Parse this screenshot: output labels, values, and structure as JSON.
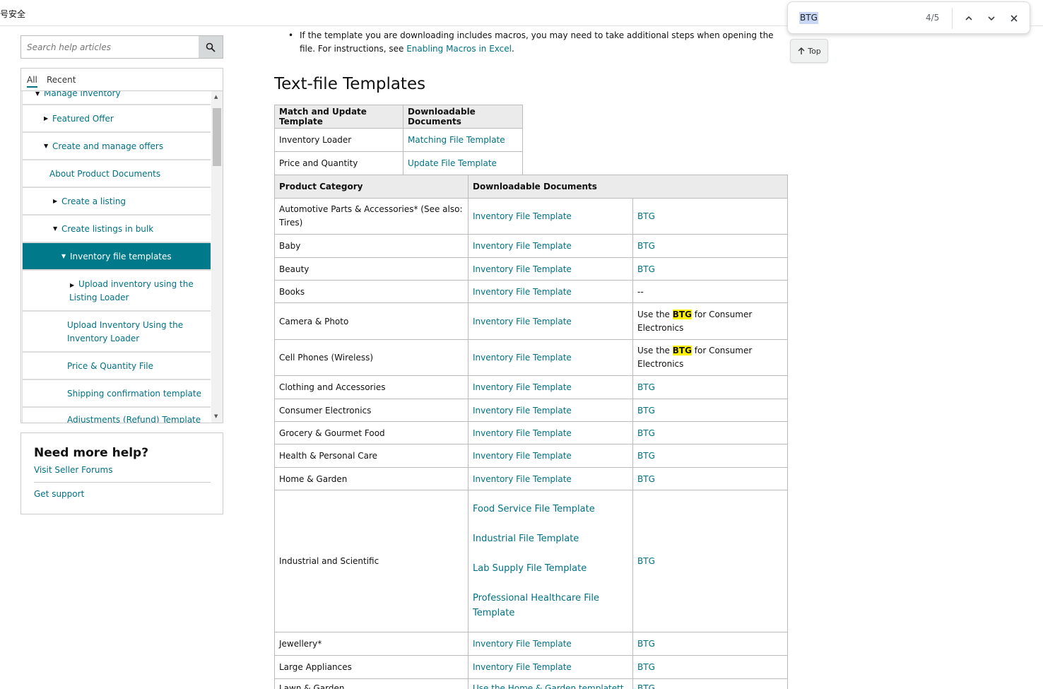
{
  "window": {
    "title": "号安全"
  },
  "find_bar": {
    "query": "BTG",
    "count": "4/5"
  },
  "top_button": {
    "label": "Top"
  },
  "sidebar": {
    "search_placeholder": "Search help articles",
    "tabs": [
      "All",
      "Recent"
    ],
    "items": [
      {
        "label": "Manage inventory"
      },
      {
        "label": "Featured Offer"
      },
      {
        "label": "Create and manage offers"
      },
      {
        "label": "About Product Documents"
      },
      {
        "label": "Create a listing"
      },
      {
        "label": "Create listings in bulk"
      },
      {
        "label": "Inventory file templates"
      },
      {
        "label": "Upload inventory using the",
        "label2": "Listing Loader"
      },
      {
        "label": "Upload Inventory Using the",
        "label2": "Inventory Loader"
      },
      {
        "label": "Price & Quantity File"
      },
      {
        "label": "Shipping confirmation template"
      },
      {
        "label": "Adjustments (Refund) Template"
      }
    ],
    "help": {
      "title": "Need more help?",
      "link1": "Visit Seller Forums",
      "link2": "Get support"
    }
  },
  "main": {
    "bullet_text": "If the template you are downloading includes macros, you may need to take additional steps when opening the file. For instructions, see ",
    "bullet_link": "Enabling Macros in Excel",
    "bullet_end": ".",
    "section_title": "Text-file Templates",
    "table1": {
      "headers": [
        "Match and Update Template",
        "Downloadable Documents"
      ],
      "rows": [
        [
          "Inventory Loader",
          "Matching File Template"
        ],
        [
          "Price and Quantity",
          "Update File Template"
        ]
      ]
    },
    "table2": {
      "headers": [
        "Product Category",
        "Downloadable Documents"
      ],
      "inventory_link": "Inventory File Template",
      "btg": "BTG",
      "dash": "--",
      "use_the": "Use the ",
      "for_ce": " for Consumer Electronics",
      "rows": [
        {
          "category": "Automotive Parts & Accessories* (See also: Tires)",
          "btg": "BTG"
        },
        {
          "category": "Baby",
          "btg": "BTG"
        },
        {
          "category": "Beauty",
          "btg": "BTG"
        },
        {
          "category": "Books",
          "btg": "--"
        },
        {
          "category": "Camera & Photo",
          "btg": "ce"
        },
        {
          "category": "Cell Phones (Wireless)",
          "btg": "ce"
        },
        {
          "category": "Clothing and Accessories",
          "btg": "BTG"
        },
        {
          "category": "Consumer Electronics",
          "btg": "BTG"
        },
        {
          "category": "Grocery & Gourmet Food",
          "btg": "BTG"
        },
        {
          "category": "Health & Personal Care",
          "btg": "BTG"
        },
        {
          "category": "Home & Garden",
          "btg": "BTG"
        },
        {
          "category": "Industrial and Scientific",
          "btg": "BTG"
        },
        {
          "category": "Jewellery*",
          "btg": "BTG"
        },
        {
          "category": "Large Appliances",
          "btg": "BTG"
        },
        {
          "category": "Lawn & Garden",
          "btg": "BTG"
        }
      ],
      "industrial_links": [
        "Food Service File Template",
        "Industrial File Template",
        "Lab Supply File Template",
        "Professional Healthcare File Template"
      ],
      "lawn_doc": "Use the Home & Garden templatett"
    }
  }
}
